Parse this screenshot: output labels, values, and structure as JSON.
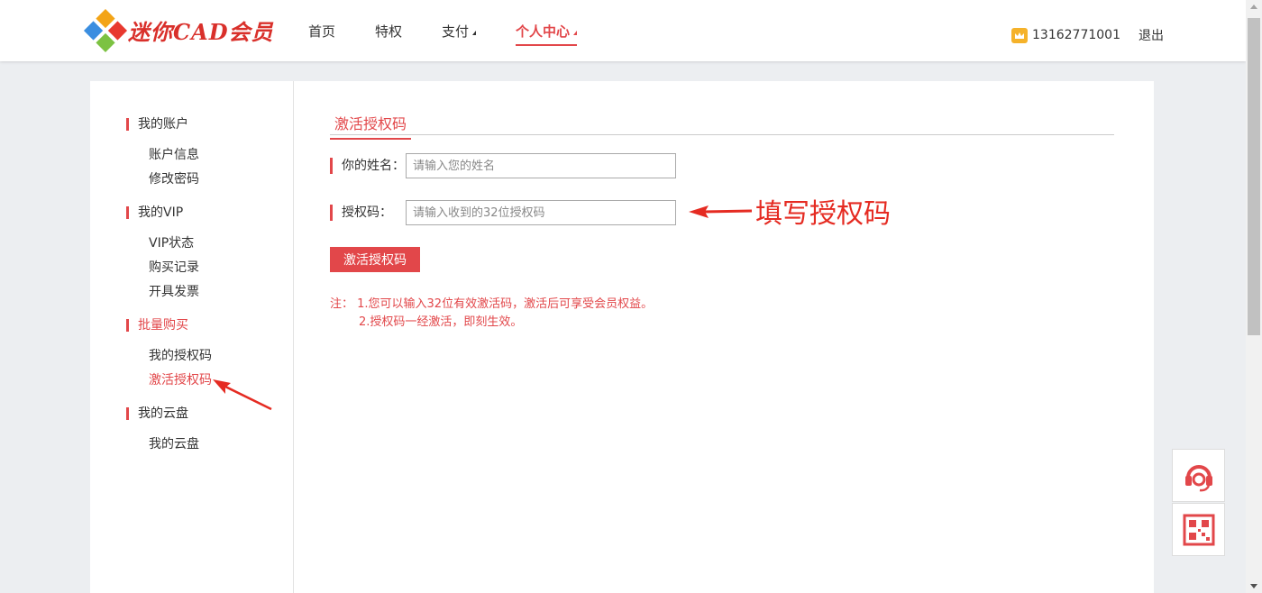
{
  "header": {
    "logo_text": "迷你CAD会员",
    "nav": [
      {
        "label": "首页",
        "has_caret": false,
        "active": false
      },
      {
        "label": "特权",
        "has_caret": false,
        "active": false
      },
      {
        "label": "支付",
        "has_caret": true,
        "active": false
      },
      {
        "label": "个人中心",
        "has_caret": true,
        "active": true
      }
    ],
    "user_phone": "13162771001",
    "logout_label": "退出"
  },
  "sidebar": {
    "groups": [
      {
        "title": "我的账户",
        "items": [
          "账户信息",
          "修改密码"
        ]
      },
      {
        "title": "我的VIP",
        "items": [
          "VIP状态",
          "购买记录",
          "开具发票"
        ]
      },
      {
        "title": "批量购买",
        "items": [
          "我的授权码",
          "激活授权码"
        ]
      },
      {
        "title": "我的云盘",
        "items": [
          "我的云盘"
        ]
      }
    ],
    "active_item": "激活授权码"
  },
  "main": {
    "tab_title": "激活授权码",
    "name_label": "你的姓名：",
    "name_placeholder": "请输入您的姓名",
    "code_label": "授权码：",
    "code_placeholder": "请输入收到的32位授权码",
    "submit_label": "激活授权码",
    "note_line1": "注： 1.您可以输入32位有效激活码，激活后可享受会员权益。",
    "note_line2": "2.授权码一经激活，即刻生效。"
  },
  "annotation": {
    "text": "填写授权码"
  },
  "colors": {
    "accent": "#e2474a",
    "annotation": "#e52b22"
  }
}
